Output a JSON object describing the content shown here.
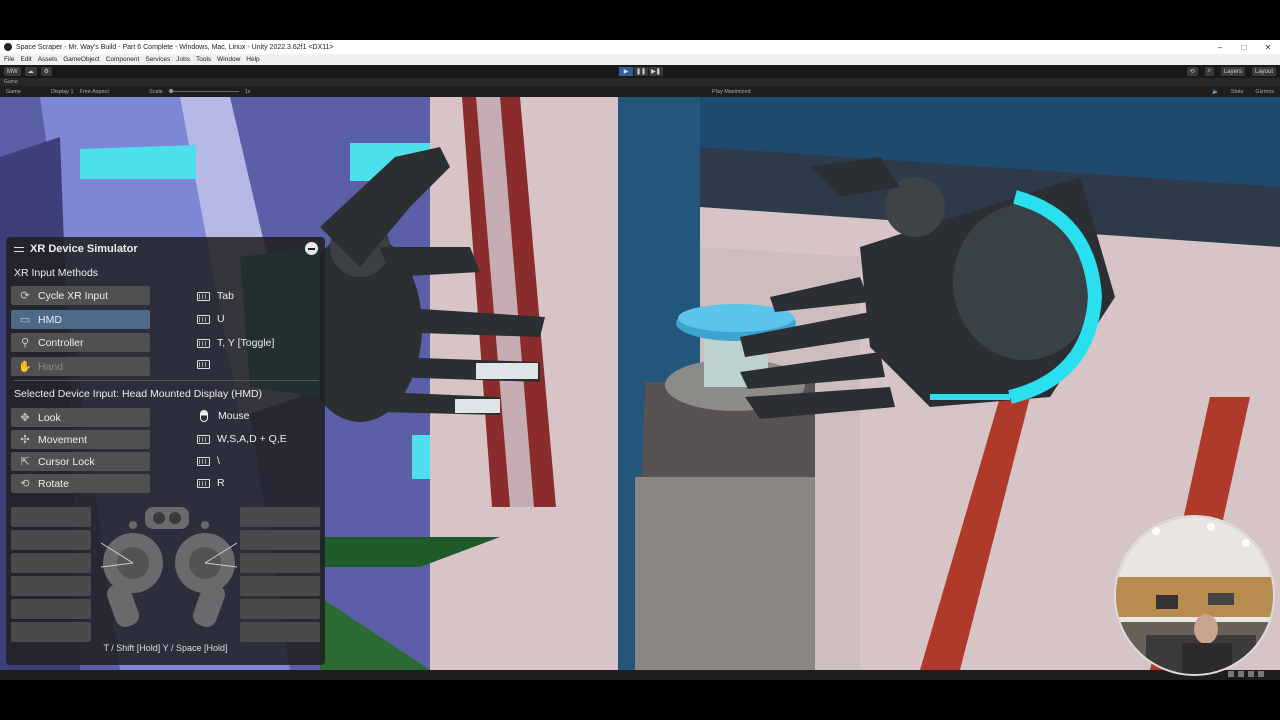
{
  "window": {
    "title": "Space Scraper - Mr. Way's Build - Part 6 Complete - Windows, Mac, Linux - Unity 2022.3.62f1 <DX11>",
    "minimize": "–",
    "maximize": "□",
    "close": "✕"
  },
  "menu": [
    "File",
    "Edit",
    "Assets",
    "GameObject",
    "Component",
    "Services",
    "Jobs",
    "Tools",
    "Window",
    "Help"
  ],
  "toolbar": {
    "account": "MW",
    "play": "▶",
    "pause": "❚❚",
    "step": "▶❚",
    "layers": "Layers",
    "layout": "Layout"
  },
  "tabs": {
    "game": "Game"
  },
  "gamebar": {
    "view": "Game",
    "display": "Display 1",
    "aspect": "Free Aspect",
    "scale_label": "Scale",
    "scale_value": "1x",
    "play_mode": "Play Maximized",
    "stats": "Stats",
    "gizmos": "Gizmos"
  },
  "simulator": {
    "title": "XR Device Simulator",
    "input_methods_label": "XR Input Methods",
    "methods": [
      {
        "label": "Cycle XR Input",
        "key": "Tab",
        "icon": "cycle-icon",
        "state": "normal"
      },
      {
        "label": "HMD",
        "key": "U",
        "icon": "hmd-icon",
        "state": "selected"
      },
      {
        "label": "Controller",
        "key": "T, Y [Toggle]",
        "icon": "controller-icon",
        "state": "normal"
      },
      {
        "label": "Hand",
        "key": "",
        "icon": "hand-icon",
        "state": "disabled"
      }
    ],
    "selected_label": "Selected Device Input: Head Mounted Display (HMD)",
    "actions": [
      {
        "label": "Look",
        "key": "Mouse",
        "icon": "look-icon",
        "key_icon": "mouse"
      },
      {
        "label": "Movement",
        "key": "W,S,A,D + Q,E",
        "icon": "move-icon",
        "key_icon": "keyboard"
      },
      {
        "label": "Cursor Lock",
        "key": "\\",
        "icon": "cursor-icon",
        "key_icon": "keyboard"
      },
      {
        "label": "Rotate",
        "key": "R",
        "icon": "rotate-icon",
        "key_icon": "keyboard"
      }
    ],
    "controller_hint": "T / Shift [Hold]  Y / Space [Hold]"
  },
  "colors": {
    "panel_bg": "#202022",
    "button_bg": "#505052",
    "button_selected": "#4d6a8a",
    "accent_cyan": "#28e0ee"
  }
}
